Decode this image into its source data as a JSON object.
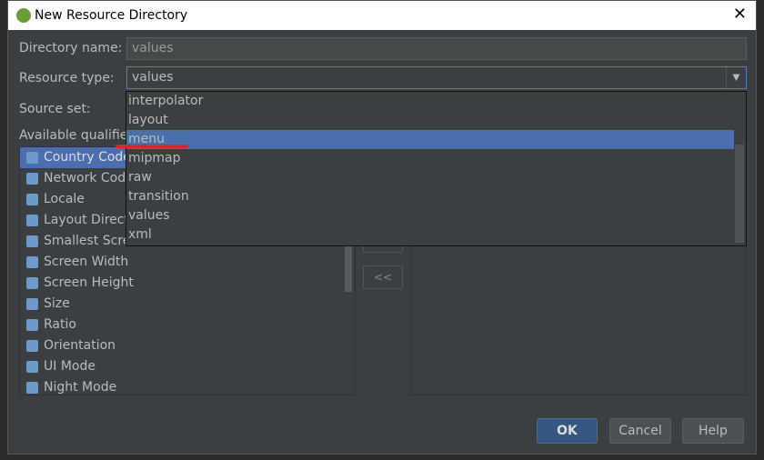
{
  "window": {
    "title": "New Resource Directory",
    "close": "✕"
  },
  "form": {
    "directory_name_label": "Directory name:",
    "directory_name_value": "values",
    "resource_type_label": "Resource type:",
    "resource_type_value": "values",
    "source_set_label": "Source set:",
    "available_qualifiers_label": "Available qualifiers:"
  },
  "qualifiers": [
    "Country Code",
    "Network Code",
    "Locale",
    "Layout Direction",
    "Smallest Screen Width",
    "Screen Width",
    "Screen Height",
    "Size",
    "Ratio",
    "Orientation",
    "UI Mode",
    "Night Mode"
  ],
  "dropdown_options": [
    "interpolator",
    "layout",
    "menu",
    "mipmap",
    "raw",
    "transition",
    "values",
    "xml"
  ],
  "dropdown_highlighted": "menu",
  "move_buttons": {
    "add": ">>",
    "remove": "<<"
  },
  "buttons": {
    "ok": "OK",
    "cancel": "Cancel",
    "help": "Help"
  },
  "colors": {
    "accent": "#4b6eaf",
    "annotation": "#e32222",
    "background": "#3c3f41"
  }
}
